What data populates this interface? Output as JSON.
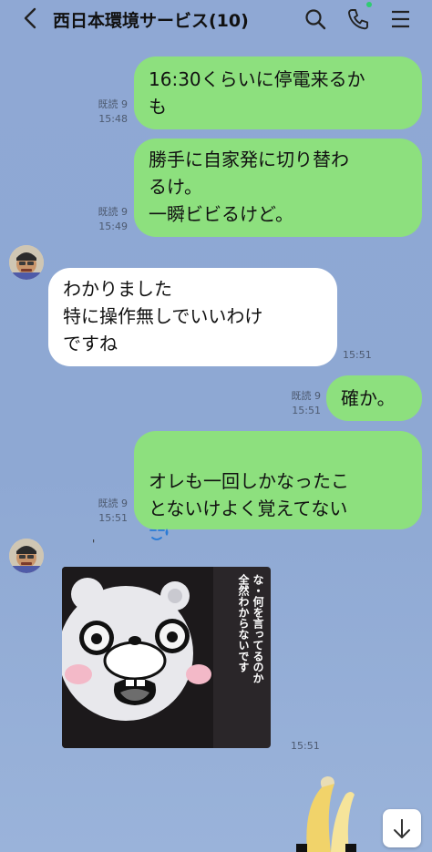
{
  "header": {
    "title": "西日本環境サービス(10)",
    "icons": [
      "back-icon",
      "search-icon",
      "phone-icon",
      "menu-icon"
    ]
  },
  "messages": [
    {
      "from": "me",
      "text": "16:30くらいに停電来るか\nも",
      "read": "既読 9",
      "time": "15:48"
    },
    {
      "from": "me",
      "text": "勝手に自家発に切り替わ\nるけ。\n一瞬ビビるけど。",
      "read": "既読 9",
      "time": "15:49"
    },
    {
      "from": "other",
      "text": "わかりました\n特に操作無しでいいわけ\nですね",
      "time": "15:51"
    },
    {
      "from": "me",
      "text": "確か。",
      "read": "既読 9",
      "time": "15:51"
    },
    {
      "from": "me",
      "text": "オレも一回しかなったこ\nとないけよく覚えてない",
      "read": "既読 9",
      "time": "15:51"
    },
    {
      "from": "other",
      "sender_mark": "'",
      "sticker_text": "な・何を言ってるのか\n全然わからないです",
      "time": "15:51"
    }
  ],
  "colors": {
    "mine_bubble": "#8de07e",
    "their_bubble": "#ffffff",
    "background": "#8fa8d4",
    "online_dot": "#2ecc71"
  }
}
